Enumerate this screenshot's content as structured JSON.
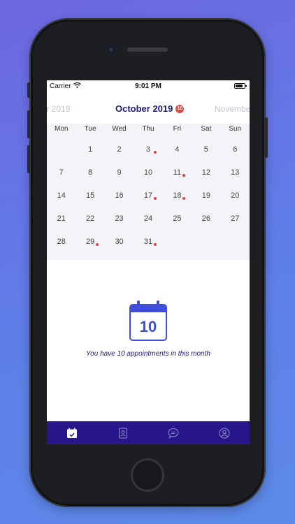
{
  "status_bar": {
    "carrier": "Carrier",
    "time": "9:01 PM"
  },
  "month_header": {
    "previous": "ber 2019",
    "current": "October 2019",
    "badge_count": "10",
    "next": "November"
  },
  "weekdays": [
    "Mon",
    "Tue",
    "Wed",
    "Thu",
    "Fri",
    "Sat",
    "Sun"
  ],
  "calendar": {
    "first_weekday_offset": 1,
    "days": [
      {
        "num": "1",
        "event": false
      },
      {
        "num": "2",
        "event": false
      },
      {
        "num": "3",
        "event": true
      },
      {
        "num": "4",
        "event": false
      },
      {
        "num": "5",
        "event": false
      },
      {
        "num": "6",
        "event": false
      },
      {
        "num": "7",
        "event": false
      },
      {
        "num": "8",
        "event": false
      },
      {
        "num": "9",
        "event": false
      },
      {
        "num": "10",
        "event": false
      },
      {
        "num": "11",
        "event": true
      },
      {
        "num": "12",
        "event": false
      },
      {
        "num": "13",
        "event": false
      },
      {
        "num": "14",
        "event": false
      },
      {
        "num": "15",
        "event": false
      },
      {
        "num": "16",
        "event": false
      },
      {
        "num": "17",
        "event": true
      },
      {
        "num": "18",
        "event": true
      },
      {
        "num": "19",
        "event": false
      },
      {
        "num": "20",
        "event": false
      },
      {
        "num": "21",
        "event": false
      },
      {
        "num": "22",
        "event": false
      },
      {
        "num": "23",
        "event": false
      },
      {
        "num": "24",
        "event": false
      },
      {
        "num": "25",
        "event": false
      },
      {
        "num": "26",
        "event": false
      },
      {
        "num": "27",
        "event": false
      },
      {
        "num": "28",
        "event": false
      },
      {
        "num": "29",
        "event": true
      },
      {
        "num": "30",
        "event": false
      },
      {
        "num": "31",
        "event": true
      }
    ]
  },
  "summary": {
    "icon_number": "10",
    "text": "You have 10 appointments in this month"
  },
  "tab_bar": {
    "tabs": [
      {
        "icon": "calendar-check-icon",
        "active": true
      },
      {
        "icon": "contacts-book-icon",
        "active": false
      },
      {
        "icon": "chat-bubble-icon",
        "active": false
      },
      {
        "icon": "profile-icon",
        "active": false
      }
    ]
  },
  "colors": {
    "accent": "#1f1b7a",
    "tab_bar": "#27168a",
    "event_dot": "#e5443f",
    "calendar_bg": "#f3f4f9",
    "icon_blue": "#3f4fd8"
  }
}
